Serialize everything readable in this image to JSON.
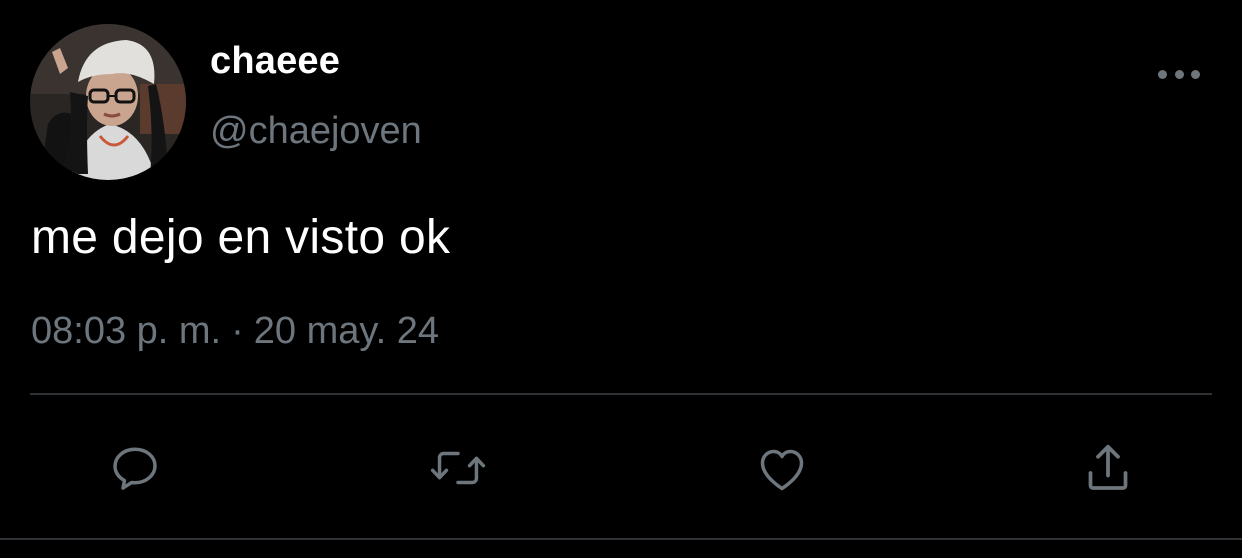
{
  "tweet": {
    "author": {
      "display_name": "chaeee",
      "handle": "@chaejoven",
      "avatar": "avatar-photo"
    },
    "text": "me dejo en visto ok",
    "timestamp": {
      "time": "08:03 p. m.",
      "separator": "·",
      "date": "20 may. 24"
    }
  },
  "actions": [
    {
      "name": "reply",
      "icon": "reply-icon"
    },
    {
      "name": "retweet",
      "icon": "retweet-icon"
    },
    {
      "name": "like",
      "icon": "heart-icon"
    },
    {
      "name": "share",
      "icon": "share-icon"
    }
  ],
  "menu": {
    "icon": "more-options-icon"
  },
  "colors": {
    "background": "#000000",
    "primary_text": "#ffffff",
    "secondary_text": "#6e767d",
    "divider": "#2f3336"
  }
}
